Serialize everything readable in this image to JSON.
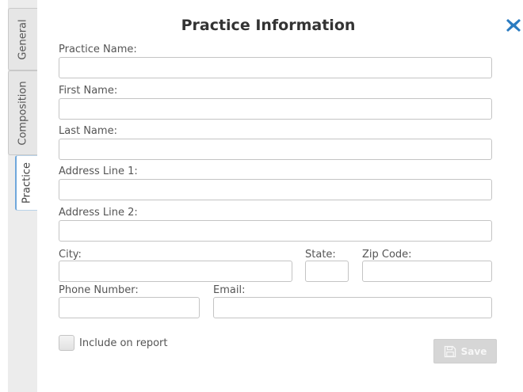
{
  "tabs": [
    {
      "label": "General"
    },
    {
      "label": "Composition"
    },
    {
      "label": "Practice",
      "selected": true
    }
  ],
  "form": {
    "title": "Practice Information",
    "close_icon": "close-x-icon",
    "accent_color": "#2a7bc1",
    "fields": {
      "practice_name": {
        "label": "Practice Name:",
        "value": ""
      },
      "first_name": {
        "label": "First Name:",
        "value": ""
      },
      "last_name": {
        "label": "Last Name:",
        "value": ""
      },
      "address_line_1": {
        "label": "Address Line 1:",
        "value": ""
      },
      "address_line_2": {
        "label": "Address Line 2:",
        "value": ""
      },
      "city": {
        "label": "City:",
        "value": ""
      },
      "state": {
        "label": "State:",
        "value": ""
      },
      "zip_code": {
        "label": "Zip Code:",
        "value": ""
      },
      "phone_number": {
        "label": "Phone Number:",
        "value": ""
      },
      "email": {
        "label": "Email:",
        "value": ""
      }
    },
    "include_on_report": {
      "label": "Include on report",
      "checked": false
    },
    "save": {
      "label": "Save",
      "icon": "floppy-disk-icon",
      "enabled": false
    }
  }
}
